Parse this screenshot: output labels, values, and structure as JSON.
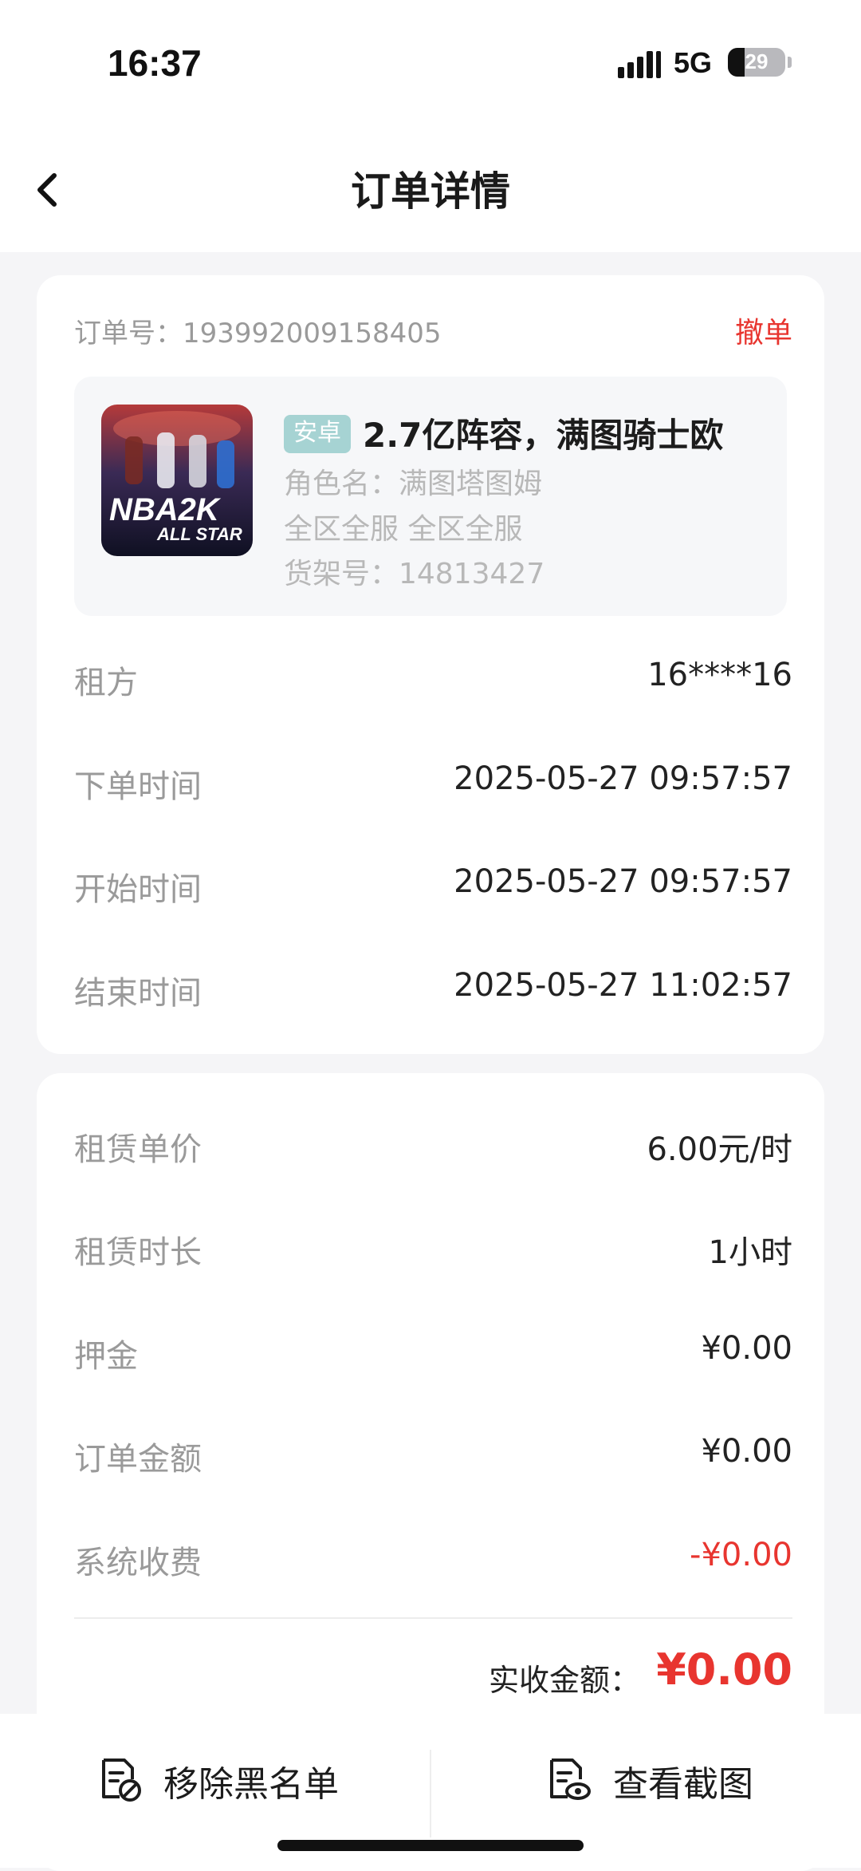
{
  "status_bar": {
    "time": "16:37",
    "network": "5G",
    "battery_level": "29",
    "battery_fraction": 0.29
  },
  "nav": {
    "title": "订单详情",
    "back_icon": "chevron-left-icon"
  },
  "order": {
    "order_no_label": "订单号：",
    "order_no": "193992009158405",
    "cancel_label": "撤单"
  },
  "product": {
    "platform_badge": "安卓",
    "title": "2.7亿阵容，满图骑士欧",
    "role_line": "角色名：满图塔图姆",
    "server_line": "全区全服  全区全服",
    "shelf_line": "货架号：14813427",
    "thumbnail_text_main": "NBA2K",
    "thumbnail_text_sub": "ALL STAR"
  },
  "details": [
    {
      "label": "租方",
      "value": "16****16"
    },
    {
      "label": "下单时间",
      "value": "2025-05-27 09:57:57"
    },
    {
      "label": "开始时间",
      "value": "2025-05-27 09:57:57"
    },
    {
      "label": "结束时间",
      "value": "2025-05-27 11:02:57"
    }
  ],
  "fees": [
    {
      "label": "租赁单价",
      "value": "6.00元/时"
    },
    {
      "label": "租赁时长",
      "value": "1小时"
    },
    {
      "label": "押金",
      "value": "¥0.00"
    },
    {
      "label": "订单金额",
      "value": "¥0.00"
    },
    {
      "label": "系统收费",
      "value": "-¥0.00"
    }
  ],
  "total": {
    "label": "实收金额：",
    "value": "¥0.00"
  },
  "actions": {
    "remove_blacklist": "移除黑名单",
    "view_screenshot": "查看截图"
  },
  "colors": {
    "accent_red": "#e8352f",
    "badge_teal": "#a6d3d3",
    "muted_text": "#9a9a9a",
    "background": "#f5f5f7"
  }
}
